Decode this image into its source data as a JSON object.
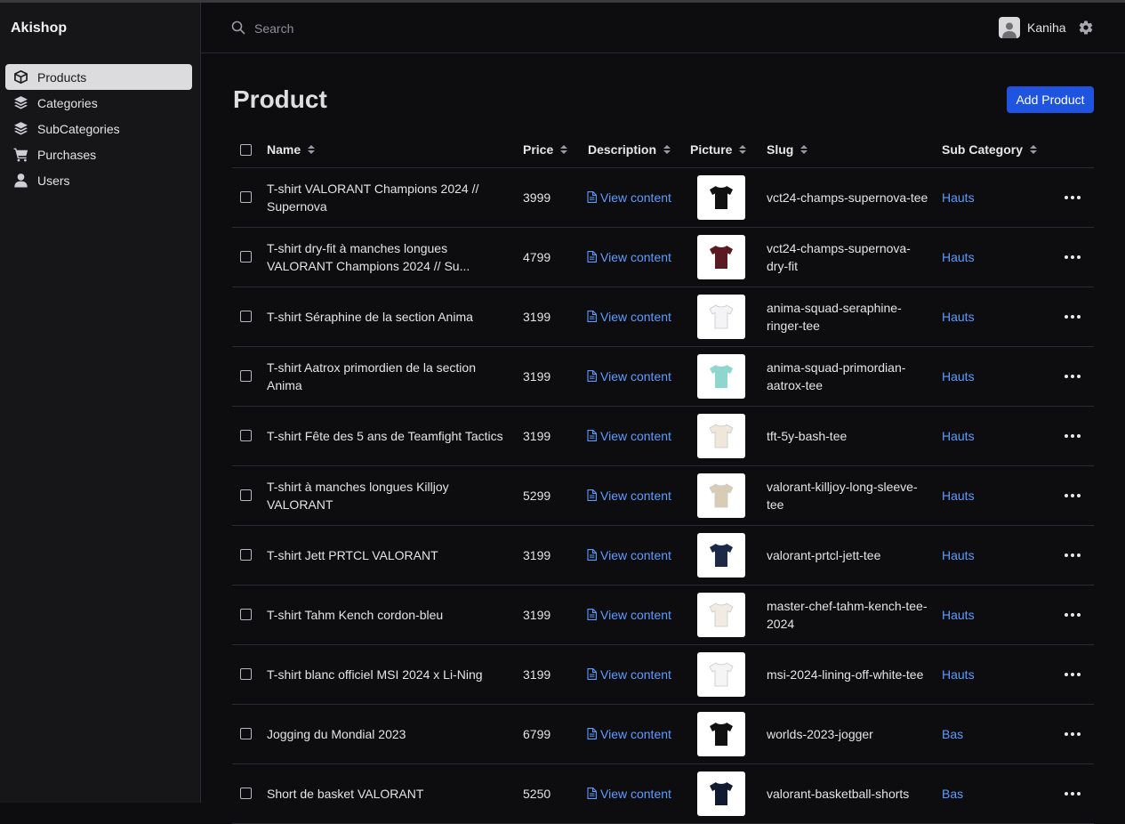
{
  "app": {
    "brand": "Akishop"
  },
  "sidebar": {
    "items": [
      {
        "label": "Products",
        "icon": "box-icon",
        "active": true
      },
      {
        "label": "Categories",
        "icon": "layers-icon",
        "active": false
      },
      {
        "label": "SubCategories",
        "icon": "layers-icon",
        "active": false
      },
      {
        "label": "Purchases",
        "icon": "cart-icon",
        "active": false
      },
      {
        "label": "Users",
        "icon": "user-icon",
        "active": false
      }
    ]
  },
  "header": {
    "search": {
      "placeholder": "Search"
    },
    "user": {
      "name": "Kaniha"
    }
  },
  "main": {
    "title": "Product",
    "add_button": "Add Product",
    "columns": [
      "Name",
      "Price",
      "Description",
      "Picture",
      "Slug",
      "Sub Category"
    ],
    "rows": [
      {
        "name": "T-shirt VALORANT Champions 2024 // Supernova",
        "price": "3999",
        "description": "View content",
        "slug": "vct24-champs-supernova-tee",
        "sub_category": "Hauts",
        "thumb": "#111111"
      },
      {
        "name": "T-shirt dry-fit à manches longues VALORANT Champions 2024 // Su...",
        "price": "4799",
        "description": "View content",
        "slug": "vct24-champs-supernova-dry-fit",
        "sub_category": "Hauts",
        "thumb": "#5a1a22"
      },
      {
        "name": "T-shirt Séraphine de la section Anima",
        "price": "3199",
        "description": "View content",
        "slug": "anima-squad-seraphine-ringer-tee",
        "sub_category": "Hauts",
        "thumb": "#f4f4f6"
      },
      {
        "name": "T-shirt Aatrox primordien de la section Anima",
        "price": "3199",
        "description": "View content",
        "slug": "anima-squad-primordian-aatrox-tee",
        "sub_category": "Hauts",
        "thumb": "#8fd6cf"
      },
      {
        "name": "T-shirt Fête des 5 ans de Teamfight Tactics",
        "price": "3199",
        "description": "View content",
        "slug": "tft-5y-bash-tee",
        "sub_category": "Hauts",
        "thumb": "#efe8d8"
      },
      {
        "name": "T-shirt à manches longues Killjoy VALORANT",
        "price": "5299",
        "description": "View content",
        "slug": "valorant-killjoy-long-sleeve-tee",
        "sub_category": "Hauts",
        "thumb": "#d8ccb4"
      },
      {
        "name": "T-shirt Jett PRTCL VALORANT",
        "price": "3199",
        "description": "View content",
        "slug": "valorant-prtcl-jett-tee",
        "sub_category": "Hauts",
        "thumb": "#1c2a48"
      },
      {
        "name": "T-shirt Tahm Kench cordon-bleu",
        "price": "3199",
        "description": "View content",
        "slug": "master-chef-tahm-kench-tee-2024",
        "sub_category": "Hauts",
        "thumb": "#f1ebe2"
      },
      {
        "name": "T-shirt blanc officiel MSI 2024 x Li-Ning",
        "price": "3199",
        "description": "View content",
        "slug": "msi-2024-lining-off-white-tee",
        "sub_category": "Hauts",
        "thumb": "#f5f5f5"
      },
      {
        "name": "Jogging du Mondial 2023",
        "price": "6799",
        "description": "View content",
        "slug": "worlds-2023-jogger",
        "sub_category": "Bas",
        "thumb": "#111111"
      },
      {
        "name": "Short de basket VALORANT",
        "price": "5250",
        "description": "View content",
        "slug": "valorant-basketball-shorts",
        "sub_category": "Bas",
        "thumb": "#121a30"
      }
    ]
  },
  "colors": {
    "accent": "#1f54e0",
    "link": "#5e9bff",
    "background": "#0d0d0f",
    "sidebar": "#161618"
  }
}
